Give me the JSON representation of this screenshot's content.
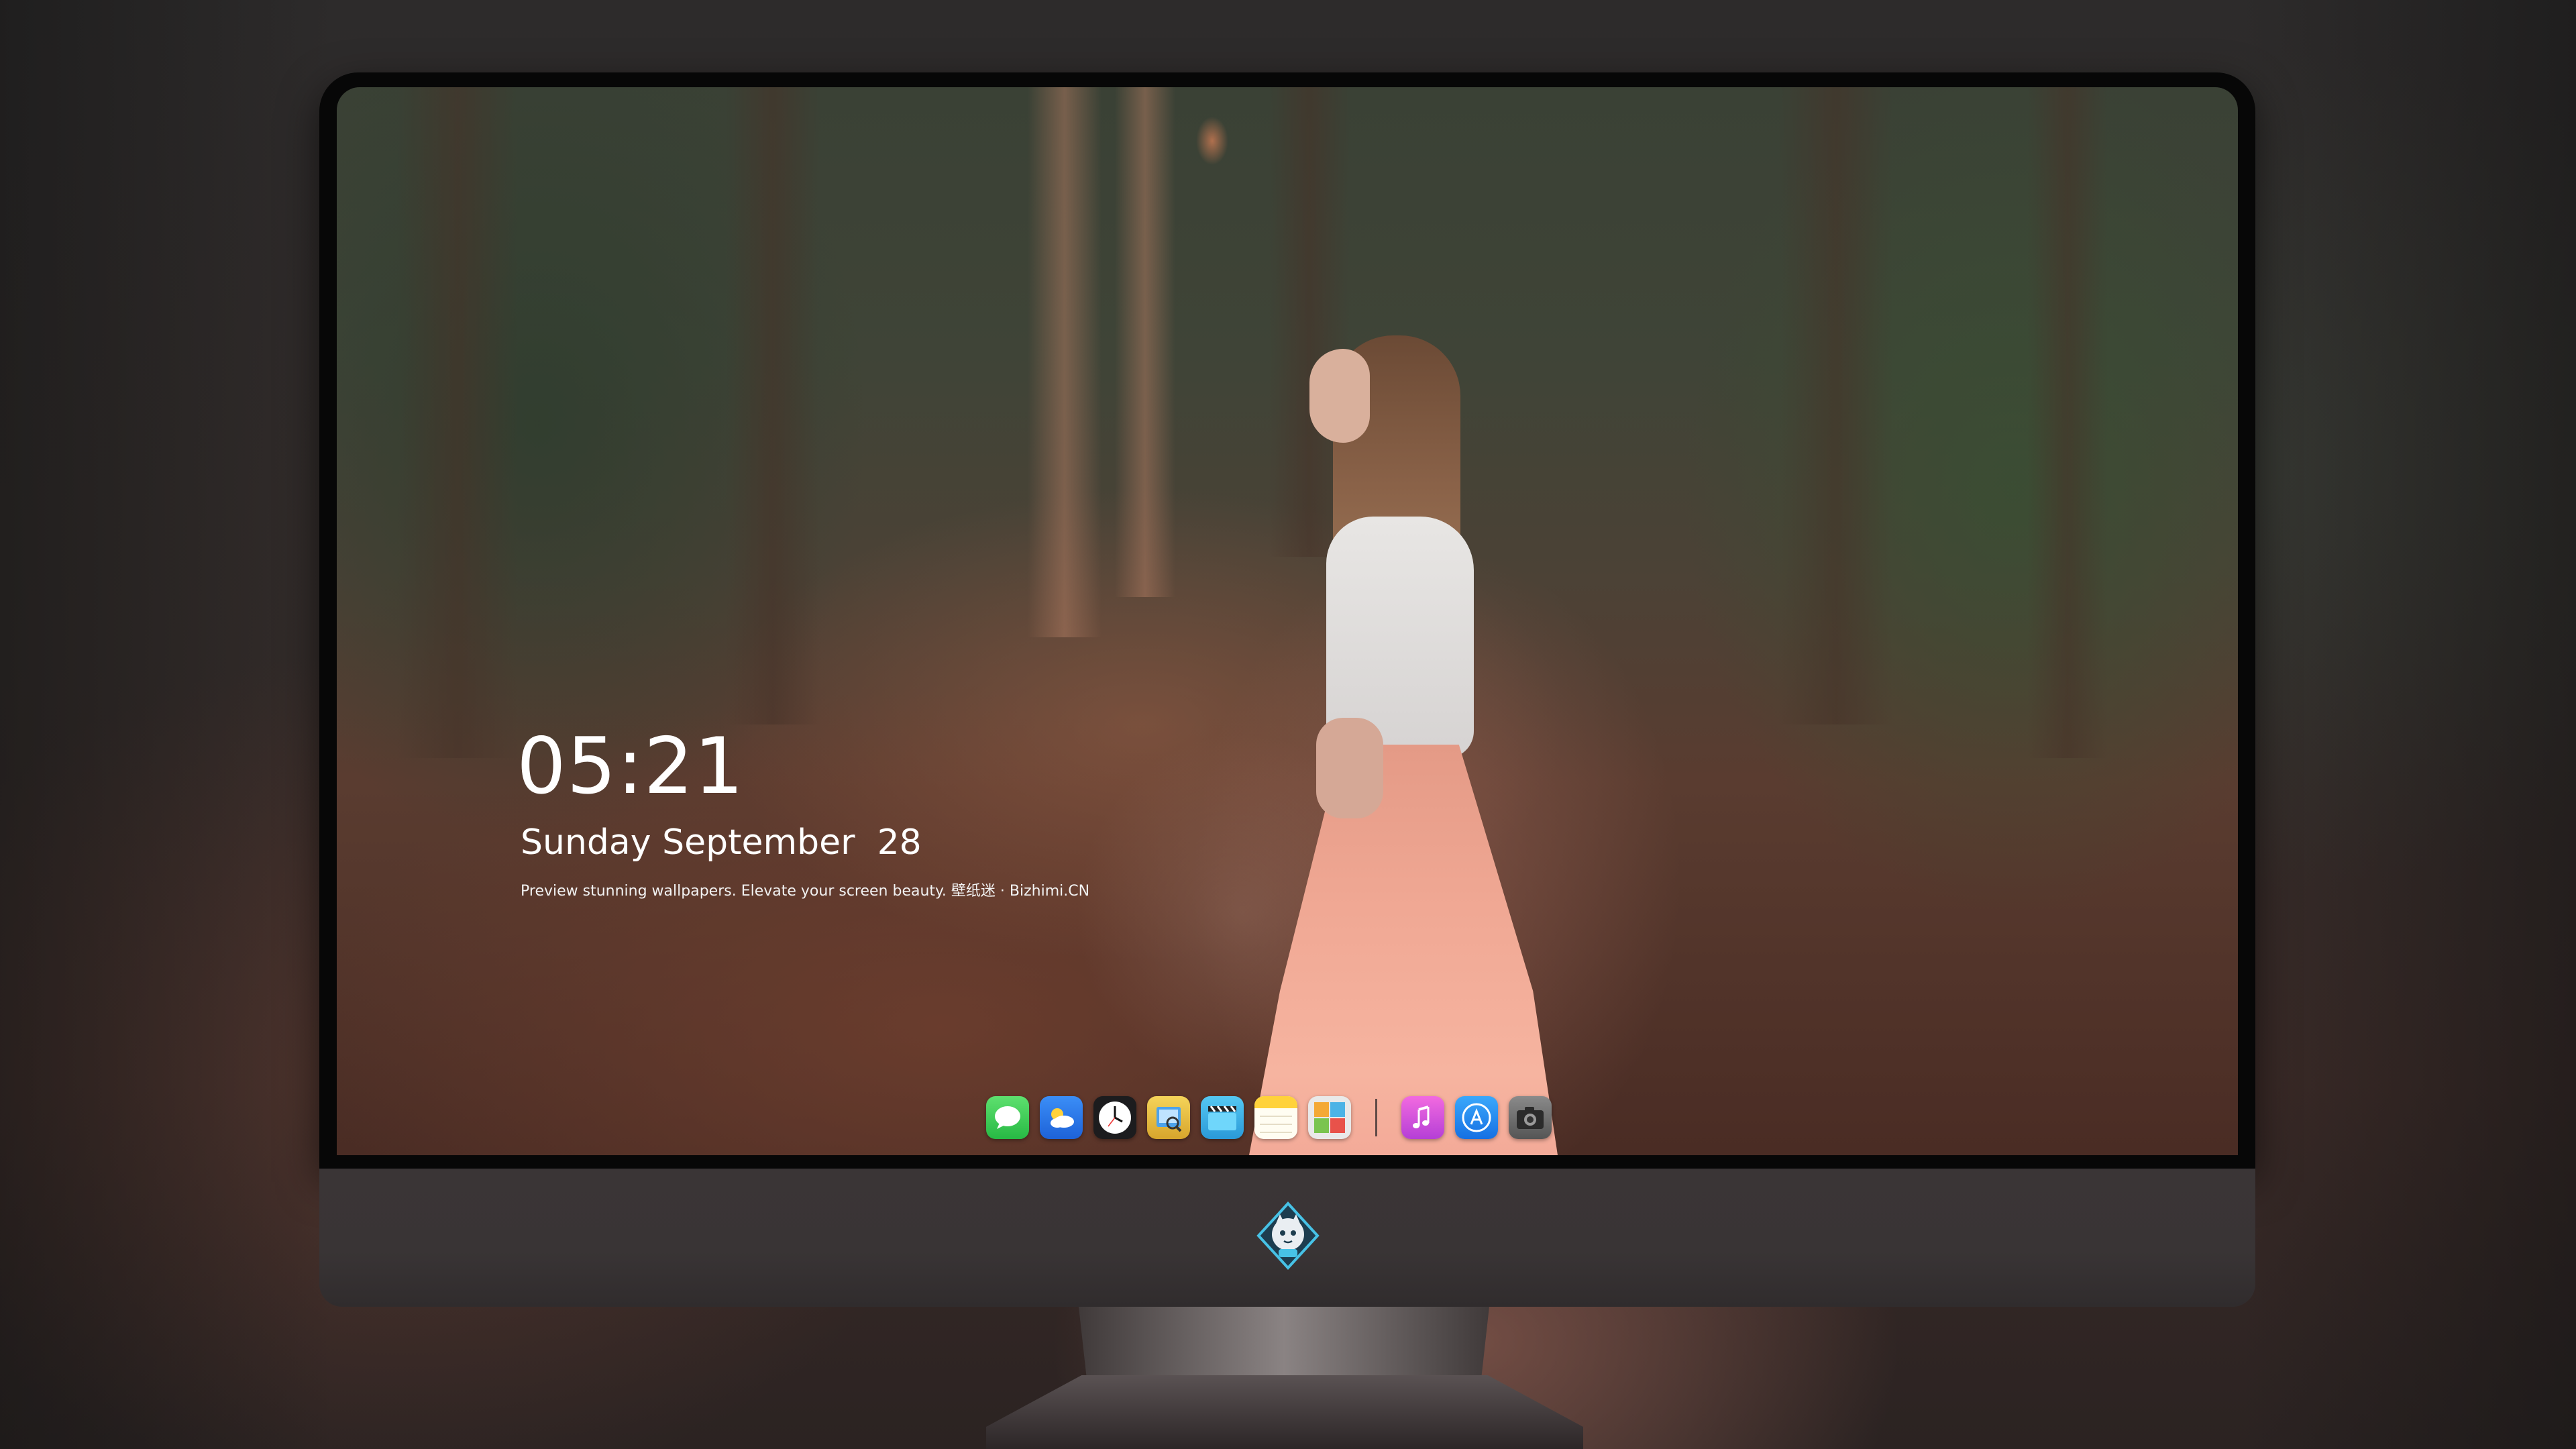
{
  "lockscreen": {
    "time": "05:21",
    "date": "Sunday September  28",
    "tagline": "Preview stunning wallpapers. Elevate your screen beauty. 壁纸迷 · Bizhimi.CN"
  },
  "dock": {
    "apps": [
      {
        "name": "messages-icon",
        "color": "#34c759"
      },
      {
        "name": "weather-icon",
        "color": "#2e7df6"
      },
      {
        "name": "clock-icon",
        "color": "#1c1c1e"
      },
      {
        "name": "preview-icon",
        "color": "#f0c94a"
      },
      {
        "name": "clips-icon",
        "color": "#3fb6e8"
      },
      {
        "name": "notes-icon",
        "color": "#ffd84d"
      },
      {
        "name": "photo-booth-icon",
        "color": "#e9e9e9"
      },
      {
        "name": "itunes-icon",
        "color": "#e044d6"
      },
      {
        "name": "app-store-icon",
        "color": "#1e8cf0"
      },
      {
        "name": "camera-icon",
        "color": "#6e6e6e"
      }
    ]
  },
  "monitor": {
    "logo": "bizhimi-logo"
  }
}
